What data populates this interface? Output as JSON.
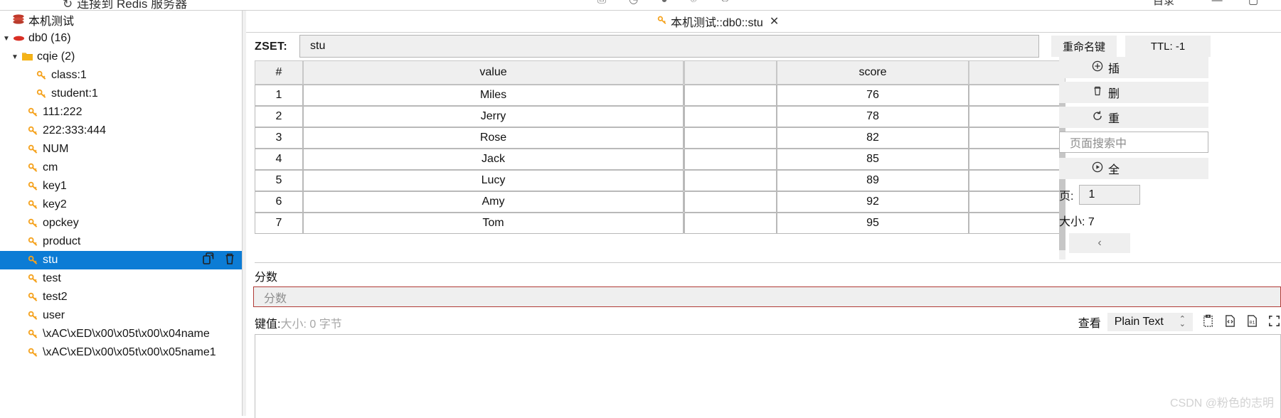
{
  "window": {
    "clipped_title": "连接到 Redis 服务器",
    "spinner_icon": "refresh-icon",
    "minimize_label": "—",
    "maximize_label": "▢",
    "right_clipped_label": "目录",
    "toolbar_icons": [
      "import-icon",
      "clock-icon",
      "circle-icon",
      "bulb-icon",
      "share-icon"
    ]
  },
  "sidebar": {
    "items": [
      {
        "label": "本机测试",
        "icon": "server-stack-icon",
        "arrow": "",
        "indent": "ind0",
        "selected": false
      },
      {
        "label": "db0  (16)",
        "icon": "database-icon",
        "arrow": "▼",
        "indent": "ind1",
        "selected": false
      },
      {
        "label": "cqie (2)",
        "icon": "folder-icon",
        "arrow": "▼",
        "indent": "ind2",
        "selected": false
      },
      {
        "label": "class:1",
        "icon": "key-icon",
        "arrow": "",
        "indent": "ind3",
        "selected": false
      },
      {
        "label": "student:1",
        "icon": "key-icon",
        "arrow": "",
        "indent": "ind3",
        "selected": false
      },
      {
        "label": "111:222",
        "icon": "key-icon",
        "arrow": "",
        "indent": "ind2b",
        "selected": false
      },
      {
        "label": "222:333:444",
        "icon": "key-icon",
        "arrow": "",
        "indent": "ind2b",
        "selected": false
      },
      {
        "label": "NUM",
        "icon": "key-icon",
        "arrow": "",
        "indent": "ind2b",
        "selected": false
      },
      {
        "label": "cm",
        "icon": "key-icon",
        "arrow": "",
        "indent": "ind2b",
        "selected": false
      },
      {
        "label": "key1",
        "icon": "key-icon",
        "arrow": "",
        "indent": "ind2b",
        "selected": false
      },
      {
        "label": "key2",
        "icon": "key-icon",
        "arrow": "",
        "indent": "ind2b",
        "selected": false
      },
      {
        "label": "opckey",
        "icon": "key-icon",
        "arrow": "",
        "indent": "ind2b",
        "selected": false
      },
      {
        "label": "product",
        "icon": "key-icon",
        "arrow": "",
        "indent": "ind2b",
        "selected": false
      },
      {
        "label": "stu",
        "icon": "key-icon",
        "arrow": "",
        "indent": "ind2b",
        "selected": true
      },
      {
        "label": "test",
        "icon": "key-icon",
        "arrow": "",
        "indent": "ind2b",
        "selected": false
      },
      {
        "label": "test2",
        "icon": "key-icon",
        "arrow": "",
        "indent": "ind2b",
        "selected": false
      },
      {
        "label": "user",
        "icon": "key-icon",
        "arrow": "",
        "indent": "ind2b",
        "selected": false
      },
      {
        "label": "\\xAC\\xED\\x00\\x05t\\x00\\x04name",
        "icon": "key-icon",
        "arrow": "",
        "indent": "ind2b",
        "selected": false
      },
      {
        "label": "\\xAC\\xED\\x00\\x05t\\x00\\x05name1",
        "icon": "key-icon",
        "arrow": "",
        "indent": "ind2b",
        "selected": false
      }
    ],
    "selected_row_actions": [
      "copy-key-icon",
      "delete-key-icon"
    ]
  },
  "tab": {
    "icon": "key-icon",
    "title": "本机测试::db0::stu",
    "close_label": "✕"
  },
  "key_header": {
    "type_label": "ZSET:",
    "key_name": "stu",
    "rename_button": "重命名键",
    "ttl_button": "TTL: -1"
  },
  "table": {
    "columns": [
      "#",
      "value",
      "",
      "score",
      ""
    ],
    "rows": [
      {
        "index": "1",
        "value": "Miles",
        "score": "76"
      },
      {
        "index": "2",
        "value": "Jerry",
        "score": "78"
      },
      {
        "index": "3",
        "value": "Rose",
        "score": "82"
      },
      {
        "index": "4",
        "value": "Jack",
        "score": "85"
      },
      {
        "index": "5",
        "value": "Lucy",
        "score": "89"
      },
      {
        "index": "6",
        "value": "Amy",
        "score": "92"
      },
      {
        "index": "7",
        "value": "Tom",
        "score": "95"
      }
    ]
  },
  "annotation": {
    "color": "#ee2222",
    "target": "score-column"
  },
  "score_editor": {
    "label": "分数",
    "placeholder": "分数",
    "border_color": "#b03a36"
  },
  "value_editor": {
    "key_value_label": "键值:",
    "size_text": "大小: 0 字节",
    "view_label": "查看",
    "view_format": "Plain Text",
    "tool_icons": [
      "clipboard-icon",
      "code-icon",
      "binary-icon",
      "fullscreen-icon"
    ],
    "content": ""
  },
  "right_panel": {
    "buttons": [
      {
        "icon": "plus-circle-icon",
        "label": "插"
      },
      {
        "icon": "trash-icon",
        "label": "删"
      },
      {
        "icon": "refresh-icon",
        "label": "重"
      }
    ],
    "search_placeholder": "页面搜索中",
    "scan_button": {
      "icon": "play-circle-icon",
      "label": "全"
    },
    "page_label": "页:",
    "page_value": "1",
    "size_label": "大小: 7",
    "prev_button": "‹"
  },
  "watermark": "CSDN @粉色的志明"
}
